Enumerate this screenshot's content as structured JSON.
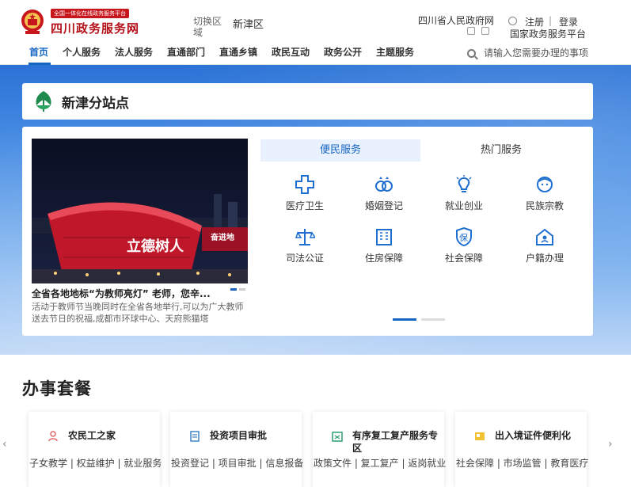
{
  "header": {
    "logo_tag": "全国一体化在线政务服务平台",
    "site_title": "四川政务服务网",
    "switch_area": "切换区域",
    "current_area": "新津区",
    "gov_link": "四川省人民政府网",
    "register": "注册",
    "separator": "|",
    "login": "登录",
    "national_platform": "国家政务服务平台"
  },
  "nav": {
    "items": [
      "首页",
      "个人服务",
      "法人服务",
      "直通部门",
      "直通乡镇",
      "政民互动",
      "政务公开",
      "主题服务"
    ],
    "search_placeholder": "请输入您需要办理的事项"
  },
  "substation": {
    "title": "新津分站点"
  },
  "news": {
    "title": "全省各地地标“为教师亮灯” 老师，您辛...",
    "description": "活动于教师节当晚同时在全省各地举行,可以为广大教师送去节日的祝福,成都市环球中心、天府熊猫塔",
    "photo_sign_left": "立德树人",
    "photo_sign_right": "奋进地"
  },
  "service_tabs": [
    "便民服务",
    "热门服务"
  ],
  "services": [
    {
      "label": "医疗卫生",
      "icon": "medical-cross-icon"
    },
    {
      "label": "婚姻登记",
      "icon": "rings-icon"
    },
    {
      "label": "就业创业",
      "icon": "lightbulb-icon"
    },
    {
      "label": "民族宗教",
      "icon": "ethnic-face-icon"
    },
    {
      "label": "司法公证",
      "icon": "scales-icon"
    },
    {
      "label": "住房保障",
      "icon": "housing-icon"
    },
    {
      "label": "社会保障",
      "icon": "shield-bao-icon"
    },
    {
      "label": "户籍办理",
      "icon": "home-id-icon"
    }
  ],
  "packages": {
    "title": "办事套餐",
    "prev_arrow": "‹",
    "next_arrow": "›",
    "items": [
      {
        "name": "农民工之家",
        "icon": "worker-icon",
        "links": "子女教学 | 权益维护 | 就业服务"
      },
      {
        "name": "投资项目审批",
        "icon": "document-icon",
        "links": "投资登记 | 项目审批 | 信息报备"
      },
      {
        "name": "有序复工复产服务专区",
        "icon": "factory-icon",
        "links": "政策文件 | 复工复产 | 返岗就业"
      },
      {
        "name": "出入境证件便利化",
        "icon": "passport-icon",
        "links": "社会保障 | 市场监管 | 教育医疗"
      }
    ]
  },
  "colors": {
    "brand_red": "#b3111a",
    "accent_blue": "#1565c0",
    "band_top": "#2a72d6",
    "band_bottom": "#bcd6f6"
  }
}
